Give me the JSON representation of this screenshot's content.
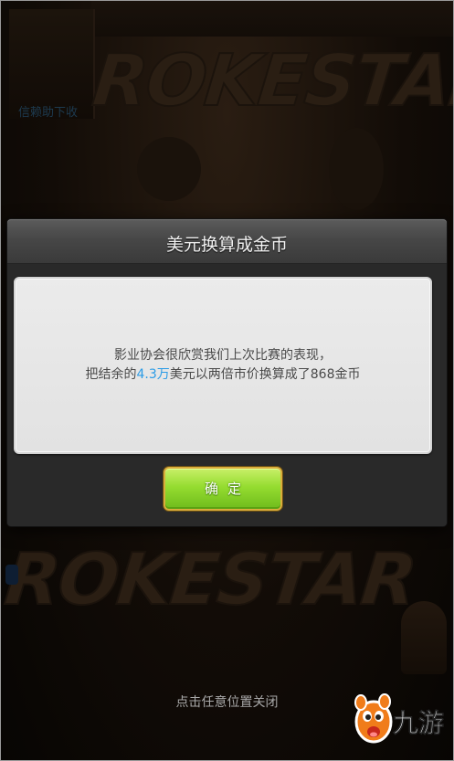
{
  "background": {
    "logo_text": "ROKESTAR",
    "small_text": "信赖助下收"
  },
  "dialog": {
    "title": "美元换算成金币",
    "message": {
      "line1": "影业协会很欣赏我们上次比赛的表现，",
      "line2_prefix": "把结余的",
      "line2_amount": "4.3万",
      "line2_suffix": "美元以两倍市价换算成了868金币"
    },
    "confirm_label": "确定"
  },
  "close_hint": "点击任意位置关闭",
  "watermark": {
    "text": "九游"
  },
  "colors": {
    "highlight": "#2a9be6",
    "button_green": "#95dc30",
    "watermark_orange": "#f07c1a"
  }
}
